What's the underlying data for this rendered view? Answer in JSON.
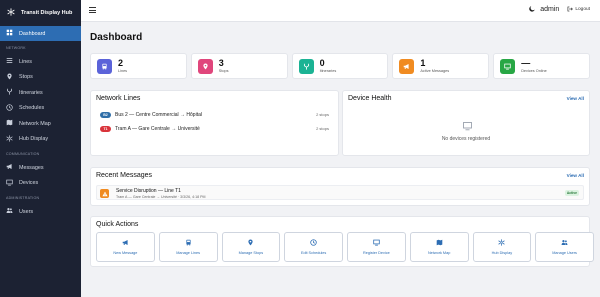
{
  "app": {
    "title": "Transit Display Hub"
  },
  "sidebar": {
    "items": [
      {
        "label": "Dashboard",
        "icon": "dashboard-icon",
        "active": true
      }
    ],
    "sections": [
      {
        "title": "NETWORK",
        "items": [
          {
            "label": "Lines",
            "icon": "lines-icon"
          },
          {
            "label": "Stops",
            "icon": "map-pin-icon"
          },
          {
            "label": "Itineraries",
            "icon": "itinerary-icon"
          },
          {
            "label": "Schedules",
            "icon": "clock-icon"
          },
          {
            "label": "Network Map",
            "icon": "map-icon"
          },
          {
            "label": "Hub Display",
            "icon": "hub-icon"
          }
        ]
      },
      {
        "title": "COMMUNICATION",
        "items": [
          {
            "label": "Messages",
            "icon": "megaphone-icon"
          },
          {
            "label": "Devices",
            "icon": "monitor-icon"
          }
        ]
      },
      {
        "title": "ADMINISTRATION",
        "items": [
          {
            "label": "Users",
            "icon": "users-icon"
          }
        ]
      }
    ]
  },
  "header": {
    "user": "admin",
    "logout_label": "Logout"
  },
  "main": {
    "title": "Dashboard",
    "stats": [
      {
        "value": "2",
        "label": "Lines",
        "color": "#5b63d9",
        "icon": "bus-icon"
      },
      {
        "value": "3",
        "label": "Stops",
        "color": "#e0467c",
        "icon": "map-pin-icon"
      },
      {
        "value": "0",
        "label": "Itineraries",
        "color": "#1bb394",
        "icon": "itinerary-icon"
      },
      {
        "value": "1",
        "label": "Active Messages",
        "color": "#f08b21",
        "icon": "megaphone-icon"
      },
      {
        "value": "—",
        "label": "Devices Online",
        "color": "#28a745",
        "icon": "monitor-icon"
      }
    ],
    "network_lines": {
      "title": "Network Lines",
      "lines": [
        {
          "badge": "B2",
          "badge_color": "#2f6ea8",
          "name": "Bus 2 — Centre Commercial → Hôpital",
          "stops": "2 stops"
        },
        {
          "badge": "T1",
          "badge_color": "#d9343b",
          "name": "Tram A — Gare Centrale → Université",
          "stops": "2 stops"
        }
      ]
    },
    "device_health": {
      "title": "Device Health",
      "view_all": "View All",
      "empty_text": "No devices registered"
    },
    "recent_messages": {
      "title": "Recent Messages",
      "view_all": "View All",
      "items": [
        {
          "title": "Service Disruption — Line T1",
          "subtitle": "Tram A — Gare Centrale → Université · 3/3/26, 4:18 PM",
          "status": "Active"
        }
      ]
    },
    "quick_actions": {
      "title": "Quick Actions",
      "items": [
        {
          "label": "New Message",
          "icon": "megaphone-icon"
        },
        {
          "label": "Manage Lines",
          "icon": "bus-icon"
        },
        {
          "label": "Manage Stops",
          "icon": "map-pin-icon"
        },
        {
          "label": "Edit Schedules",
          "icon": "clock-icon"
        },
        {
          "label": "Register Device",
          "icon": "monitor-icon"
        },
        {
          "label": "Network Map",
          "icon": "map-icon"
        },
        {
          "label": "Hub Display",
          "icon": "hub-icon"
        },
        {
          "label": "Manage Users",
          "icon": "users-icon"
        }
      ]
    }
  }
}
